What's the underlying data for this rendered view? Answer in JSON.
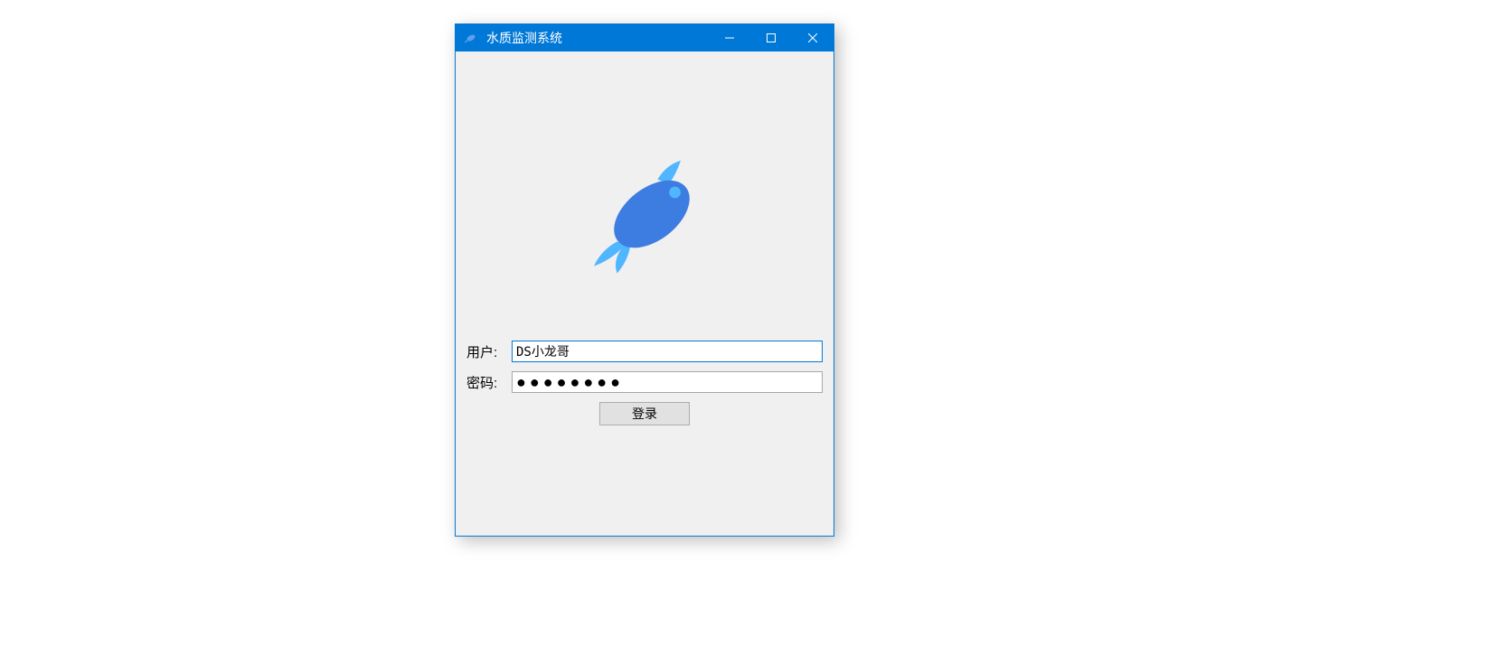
{
  "window": {
    "title": "水质监测系统",
    "icon_name": "fish-icon"
  },
  "titlebar_controls": {
    "minimize": "minimize",
    "maximize": "maximize",
    "close": "close"
  },
  "logo": {
    "name": "fish-logo"
  },
  "form": {
    "username_label": "用户:",
    "username_value": "DS小龙哥",
    "password_label": "密码:",
    "password_masked": "●●●●●●●●",
    "login_button_label": "登录"
  },
  "colors": {
    "titlebar_bg": "#0078d7",
    "window_bg": "#f0f0f0",
    "fish_body": "#3d7ce0",
    "fish_fins": "#4fb6ff"
  }
}
